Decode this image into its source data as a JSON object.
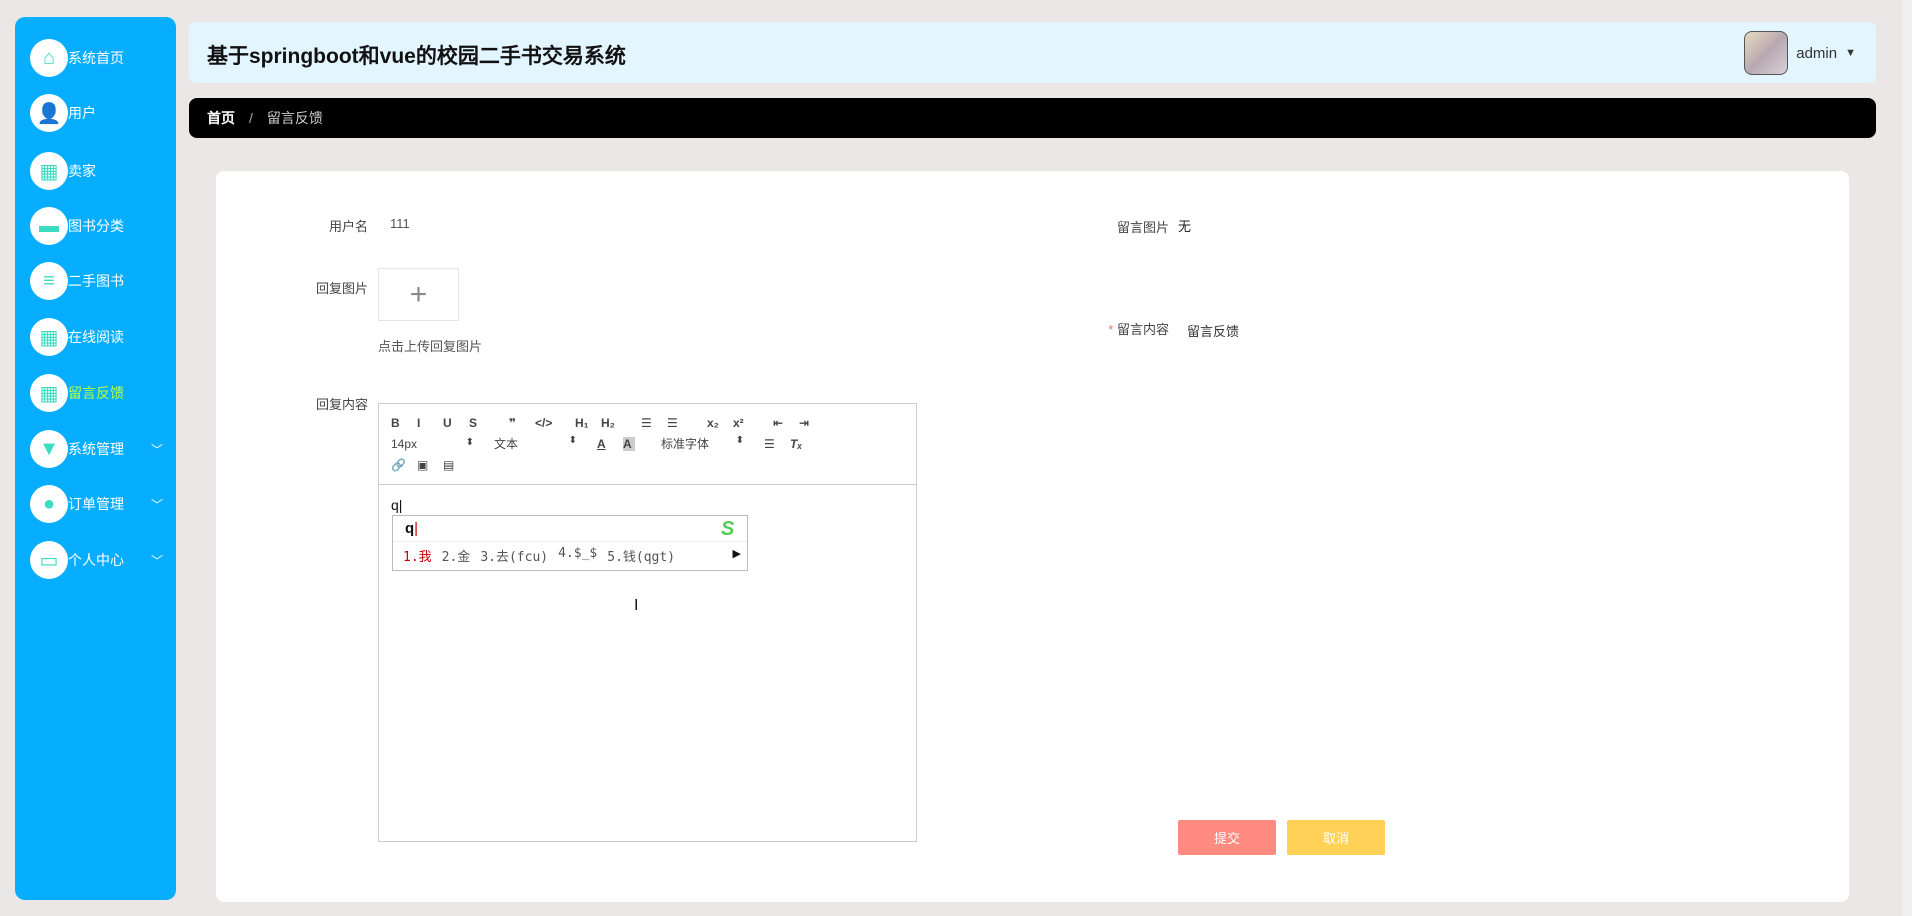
{
  "app": {
    "title": "基于springboot和vue的校园二手书交易系统",
    "user": "admin"
  },
  "sidebar": {
    "items": [
      {
        "label": "系统首页",
        "icon": "home-icon"
      },
      {
        "label": "用户",
        "icon": "user-icon"
      },
      {
        "label": "卖家",
        "icon": "grid-icon"
      },
      {
        "label": "图书分类",
        "icon": "monitor-icon"
      },
      {
        "label": "二手图书",
        "icon": "list-icon"
      },
      {
        "label": "在线阅读",
        "icon": "grid-icon"
      },
      {
        "label": "留言反馈",
        "icon": "grid-icon",
        "active": true
      },
      {
        "label": "系统管理",
        "icon": "brush-icon",
        "expandable": true
      },
      {
        "label": "订单管理",
        "icon": "bulb-icon",
        "expandable": true
      },
      {
        "label": "个人中心",
        "icon": "wallet-icon",
        "expandable": true
      }
    ]
  },
  "breadcrumb": {
    "home": "首页",
    "sep": "/",
    "current": "留言反馈"
  },
  "form": {
    "username_label": "用户名",
    "username_value": "111",
    "msg_image_label": "留言图片",
    "msg_image_value": "无",
    "reply_image_label": "回复图片",
    "upload_hint": "点击上传回复图片",
    "msg_content_label": "留言内容",
    "msg_content_value": "留言反馈",
    "required_mark": "*",
    "reply_content_label": "回复内容",
    "submit": "提交",
    "cancel": "取消"
  },
  "editor": {
    "toolbar1": [
      "B",
      "I",
      "U",
      "S",
      "❞",
      "</>",
      "H₁",
      "H₂",
      "☰",
      "☰",
      "x₂",
      "x²",
      "⇤",
      "⇥"
    ],
    "font_size": "14px",
    "header": "文本",
    "font": "标准字体",
    "content": "q",
    "ime": {
      "input": "q",
      "candidates": [
        "1.我",
        "2.金",
        "3.去(fcu)",
        "4.$_$",
        "5.钱(qgt)"
      ]
    }
  },
  "colors": {
    "sidebar": "#07aeff",
    "active": "#b6ff3a",
    "submit": "#ff8a80",
    "cancel": "#ffd257"
  }
}
